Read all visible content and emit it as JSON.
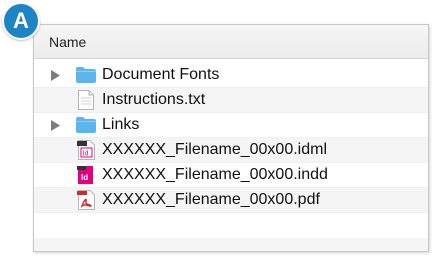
{
  "badge": {
    "letter": "A",
    "color": "#1d84c5"
  },
  "header": {
    "column_label": "Name"
  },
  "rows": [
    {
      "label": "Document Fonts",
      "icon": "folder-icon",
      "expandable": true
    },
    {
      "label": "Instructions.txt",
      "icon": "text-file-icon",
      "expandable": false
    },
    {
      "label": "Links",
      "icon": "folder-icon",
      "expandable": true
    },
    {
      "label": "XXXXXX_Filename_00x00.idml",
      "icon": "idml-file-icon",
      "expandable": false
    },
    {
      "label": "XXXXXX_Filename_00x00.indd",
      "icon": "indesign-file-icon",
      "expandable": false
    },
    {
      "label": "XXXXXX_Filename_00x00.pdf",
      "icon": "pdf-file-icon",
      "expandable": false
    }
  ],
  "colors": {
    "folder": "#5ab6ec",
    "indesign": "#e3007e",
    "pdf": "#d7282a",
    "row_alt": "#f5f5f5"
  }
}
